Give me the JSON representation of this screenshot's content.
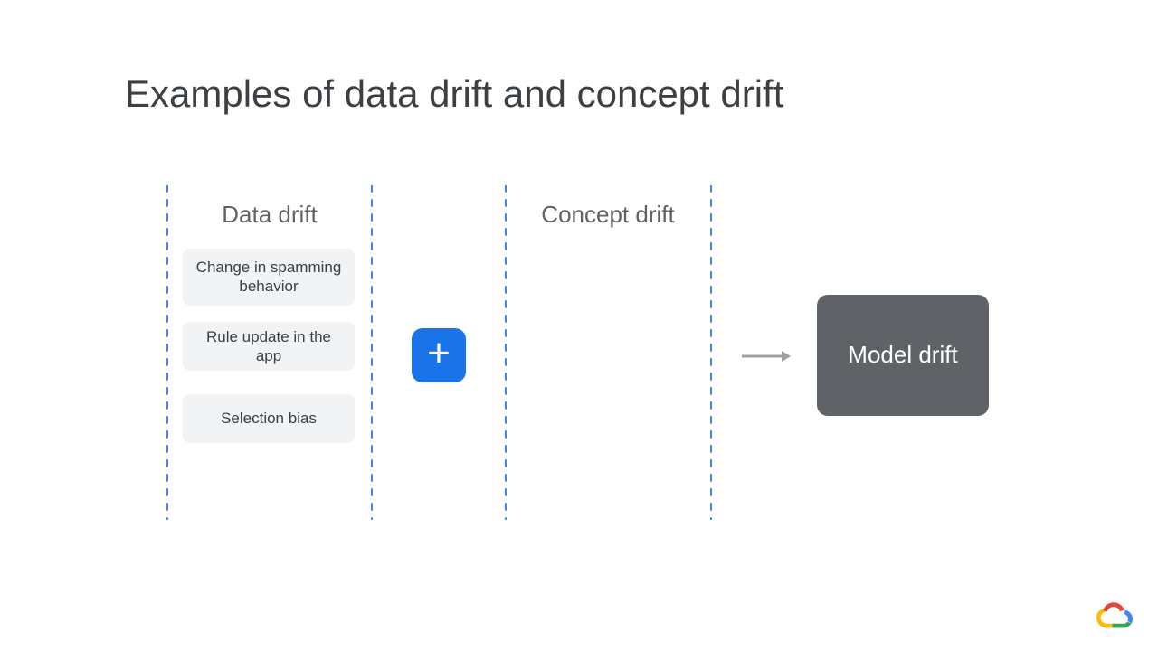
{
  "title": "Examples of data drift and concept drift",
  "columns": {
    "data_drift": {
      "heading": "Data drift",
      "items": [
        "Change in spamming behavior",
        "Rule update in the app",
        "Selection bias"
      ]
    },
    "concept_drift": {
      "heading": "Concept drift",
      "items": []
    }
  },
  "operator": "+",
  "result": "Model drift",
  "colors": {
    "dash": "#4285f4",
    "pill_bg": "#f1f3f4",
    "plus_bg": "#1a73e8",
    "result_bg": "#5f6368",
    "arrow": "#9aa0a6"
  }
}
